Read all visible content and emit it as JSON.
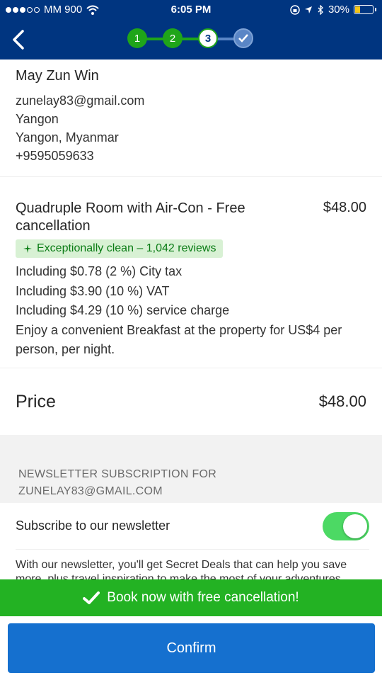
{
  "status_bar": {
    "carrier": "MM 900",
    "time": "6:05 PM",
    "battery": "30%",
    "battery_level": 0.3
  },
  "stepper": {
    "steps": [
      "1",
      "2",
      "3"
    ]
  },
  "guest": {
    "name": "May Zun Win",
    "email": "zunelay83@gmail.com",
    "city": "Yangon",
    "region": "Yangon, Myanmar",
    "phone": "+9595059633"
  },
  "room": {
    "name": "Quadruple Room with Air-Con - Free cancellation",
    "price": "$48.00",
    "badge": "Exceptionally clean – 1,042 reviews",
    "lines": [
      "Including $0.78 (2 %) City tax",
      "Including $3.90 (10 %) VAT",
      "Including $4.29 (10 %) service charge",
      "Enjoy a convenient Breakfast at the property for US$4 per person, per night."
    ]
  },
  "price": {
    "label": "Price",
    "value": "$48.00"
  },
  "newsletter": {
    "header_line1": "NEWSLETTER SUBSCRIPTION FOR",
    "header_line2": "ZUNELAY83@GMAIL.COM",
    "subscribe_label": "Subscribe to our newsletter",
    "toggle_on": true,
    "description": "With our newsletter, you'll get Secret Deals that can help you save more, plus travel inspiration to make the most of your adventures"
  },
  "banner": {
    "text": "Book now with free cancellation!"
  },
  "confirm": {
    "label": "Confirm"
  },
  "colors": {
    "brand": "#003580",
    "green": "#23b223",
    "button": "#1570cf"
  }
}
